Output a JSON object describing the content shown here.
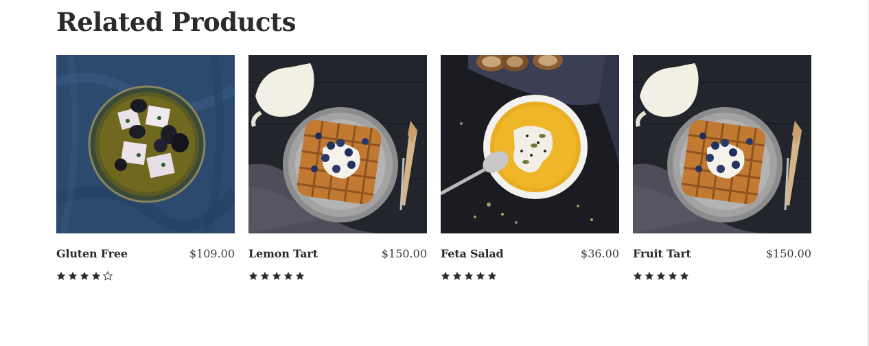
{
  "section": {
    "title": "Related Products"
  },
  "products": [
    {
      "name": "Gluten Free",
      "price": "$109.00",
      "rating": 4,
      "rating_max": 5,
      "image": "feta-olives-bowl"
    },
    {
      "name": "Lemon Tart",
      "price": "$150.00",
      "rating": 5,
      "rating_max": 5,
      "image": "waffle-plate"
    },
    {
      "name": "Feta Salad",
      "price": "$36.00",
      "rating": 5,
      "rating_max": 5,
      "image": "pumpkin-soup-bowl"
    },
    {
      "name": "Fruit Tart",
      "price": "$150.00",
      "rating": 5,
      "rating_max": 5,
      "image": "waffle-plate"
    }
  ],
  "colors": {
    "text": "#2b2b2b",
    "star": "#2b2b2b"
  }
}
